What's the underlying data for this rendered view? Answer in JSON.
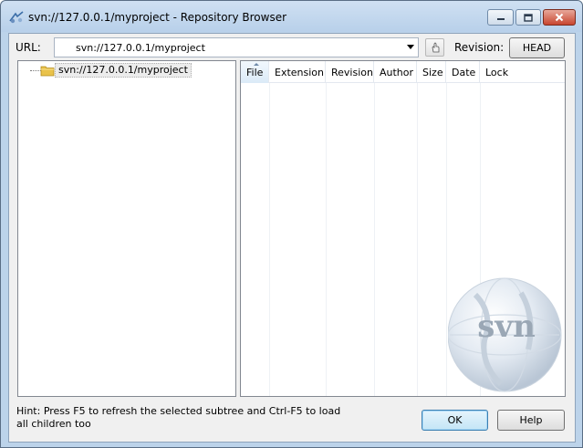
{
  "window": {
    "title": "svn://127.0.0.1/myproject - Repository Browser",
    "controls": [
      "minimize",
      "maximize",
      "close"
    ]
  },
  "toolbar": {
    "url_label": "URL:",
    "url_value": "svn://127.0.0.1/myproject",
    "revision_label": "Revision:",
    "revision_button": "HEAD"
  },
  "tree": {
    "items": [
      {
        "label": "svn://127.0.0.1/myproject",
        "icon": "folder-icon",
        "selected": true
      }
    ]
  },
  "file_list": {
    "columns": [
      "File",
      "Extension",
      "Revision",
      "Author",
      "Size",
      "Date",
      "Lock"
    ],
    "sorted_column": "File",
    "rows": []
  },
  "watermark": {
    "text": "svn"
  },
  "footer": {
    "hint": "Hint: Press F5 to refresh the selected subtree and Ctrl-F5 to load all children too",
    "ok_label": "OK",
    "help_label": "Help"
  },
  "colors": {
    "frame": "#bcd3ea",
    "client": "#f0f0f0",
    "close_button": "#c8452f",
    "default_button": "#3c7fb1"
  }
}
